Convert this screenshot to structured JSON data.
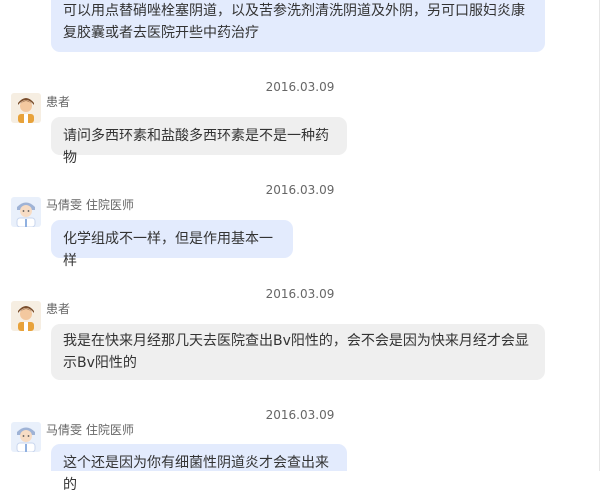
{
  "conversation": {
    "messages": [
      {
        "role": "doctor",
        "text": "可以用点替硝唑栓塞阴道，以及苦参洗剂清洗阴道及外阴，另可口服妇炎康复胶囊或者去医院开些中药治疗"
      },
      {
        "date": "2016.03.09",
        "role": "patient",
        "sender": "患者",
        "avatar_icon": "patient-avatar-icon",
        "text": "请问多西环素和盐酸多西环素是不是一种药物"
      },
      {
        "date": "2016.03.09",
        "role": "doctor",
        "sender": "马倩雯 住院医师",
        "avatar_icon": "doctor-avatar-icon",
        "text": "化学组成不一样，但是作用基本一样"
      },
      {
        "date": "2016.03.09",
        "role": "patient",
        "sender": "患者",
        "avatar_icon": "patient-avatar-icon",
        "text": "我是在快来月经那几天去医院查出Bv阳性的，会不会是因为快来月经才会显示Bv阳性的"
      },
      {
        "date": "2016.03.09",
        "role": "doctor",
        "sender": "马倩雯 住院医师",
        "avatar_icon": "doctor-avatar-icon",
        "text": "这个还是因为你有细菌性阴道炎才会查出来的"
      }
    ]
  },
  "colors": {
    "doctor_bubble": "#e3ebfd",
    "patient_bubble": "#efefef",
    "meta_text": "#666666"
  }
}
